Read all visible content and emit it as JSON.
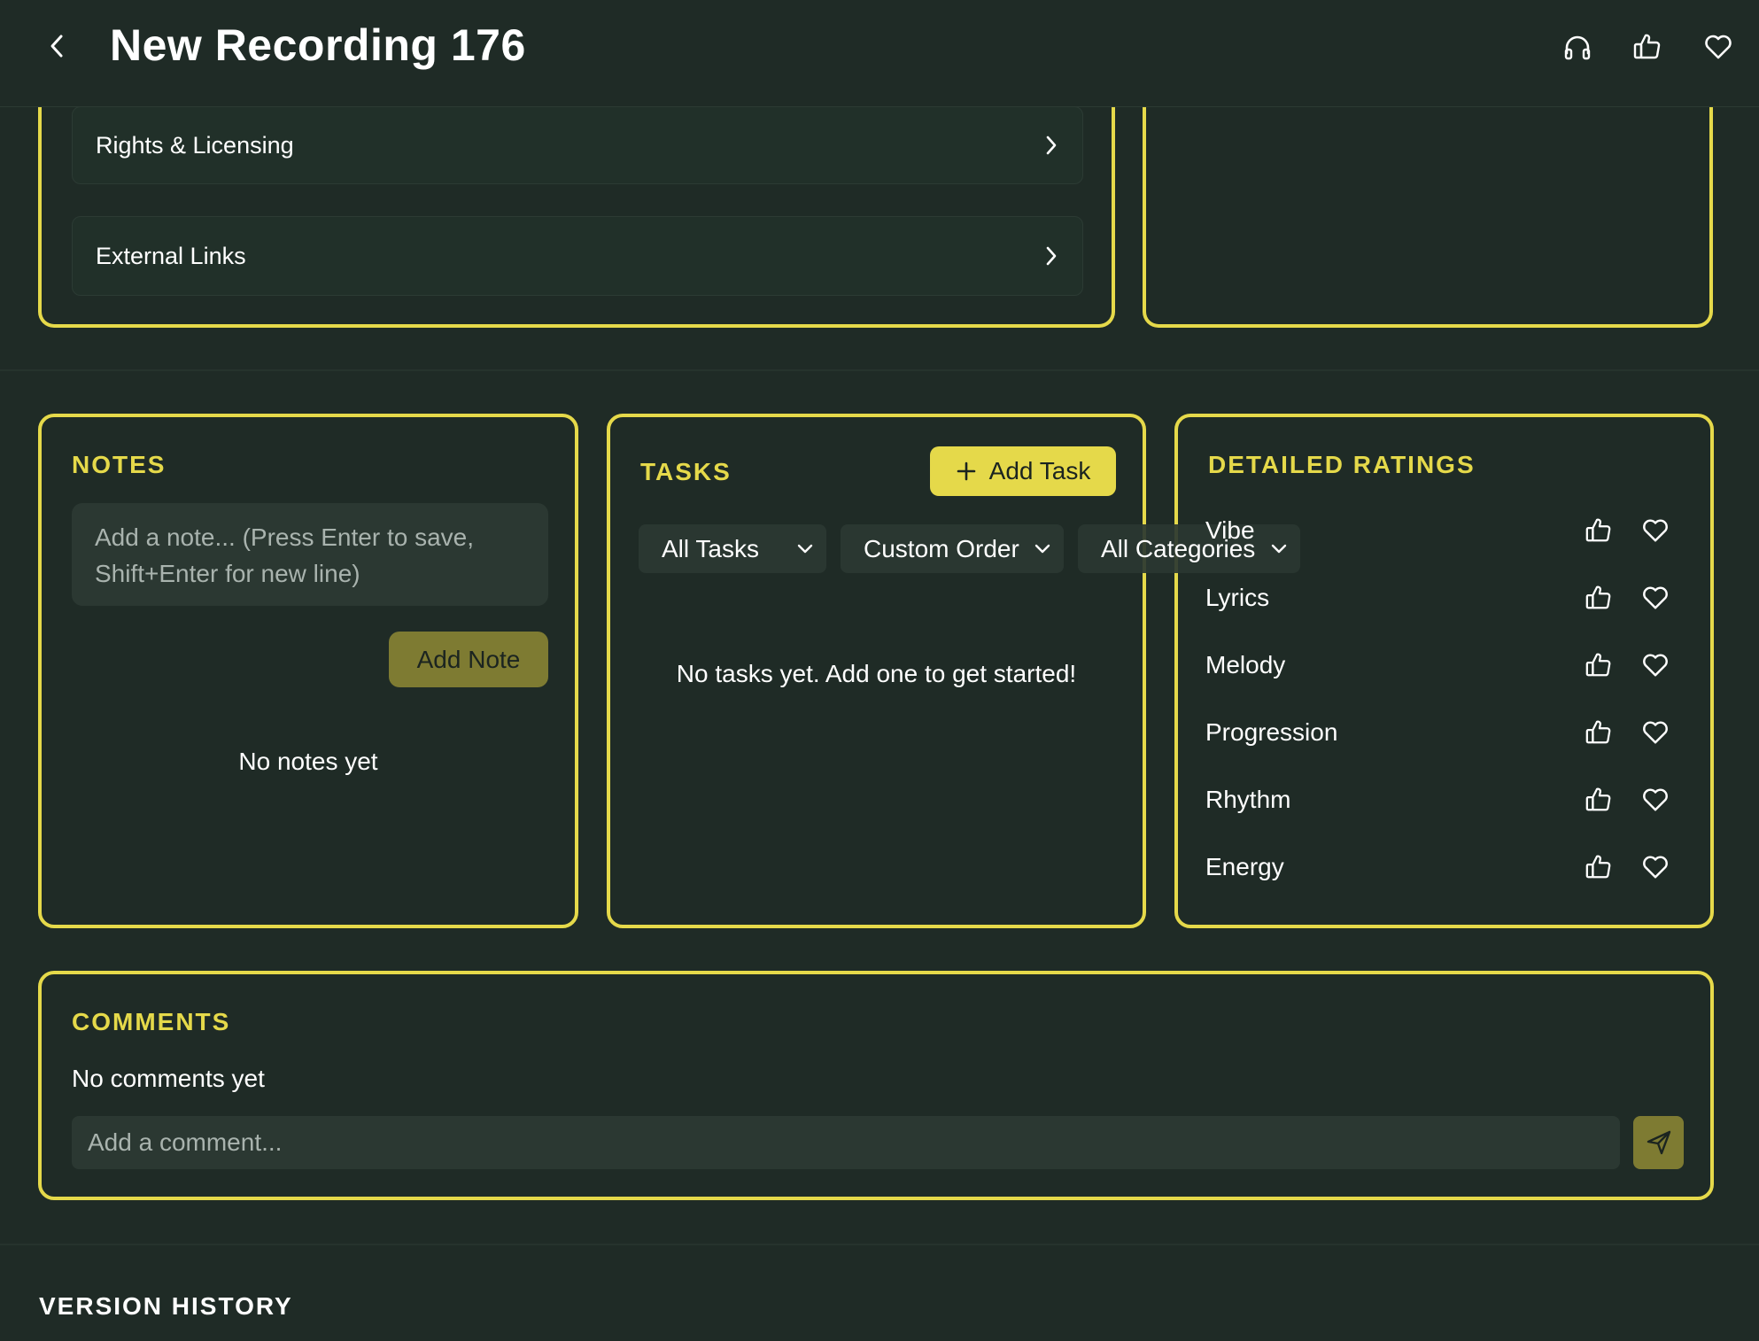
{
  "header": {
    "title": "New Recording 176",
    "back_icon": "chevron-left-icon",
    "actions": [
      "headphones-icon",
      "thumbs-up-icon",
      "heart-icon"
    ]
  },
  "metadata_panel": {
    "items": [
      {
        "label": "Rights & Licensing"
      },
      {
        "label": "External Links"
      }
    ]
  },
  "notes": {
    "title": "NOTES",
    "placeholder": "Add a note... (Press Enter to save, Shift+Enter for new line)",
    "add_button": "Add Note",
    "empty": "No notes yet"
  },
  "tasks": {
    "title": "TASKS",
    "add_button": "Add Task",
    "filters": [
      "All Tasks",
      "Custom Order",
      "All Categories"
    ],
    "empty": "No tasks yet. Add one to get started!"
  },
  "ratings": {
    "title": "DETAILED RATINGS",
    "items": [
      {
        "label": "Vibe"
      },
      {
        "label": "Lyrics"
      },
      {
        "label": "Melody"
      },
      {
        "label": "Progression"
      },
      {
        "label": "Rhythm"
      },
      {
        "label": "Energy"
      }
    ]
  },
  "comments": {
    "title": "COMMENTS",
    "empty": "No comments yet",
    "placeholder": "Add a comment..."
  },
  "version_history": {
    "title": "VERSION HISTORY"
  },
  "colors": {
    "background": "#1f2b26",
    "accent": "#e5d94a",
    "olive": "#7e7b32"
  }
}
